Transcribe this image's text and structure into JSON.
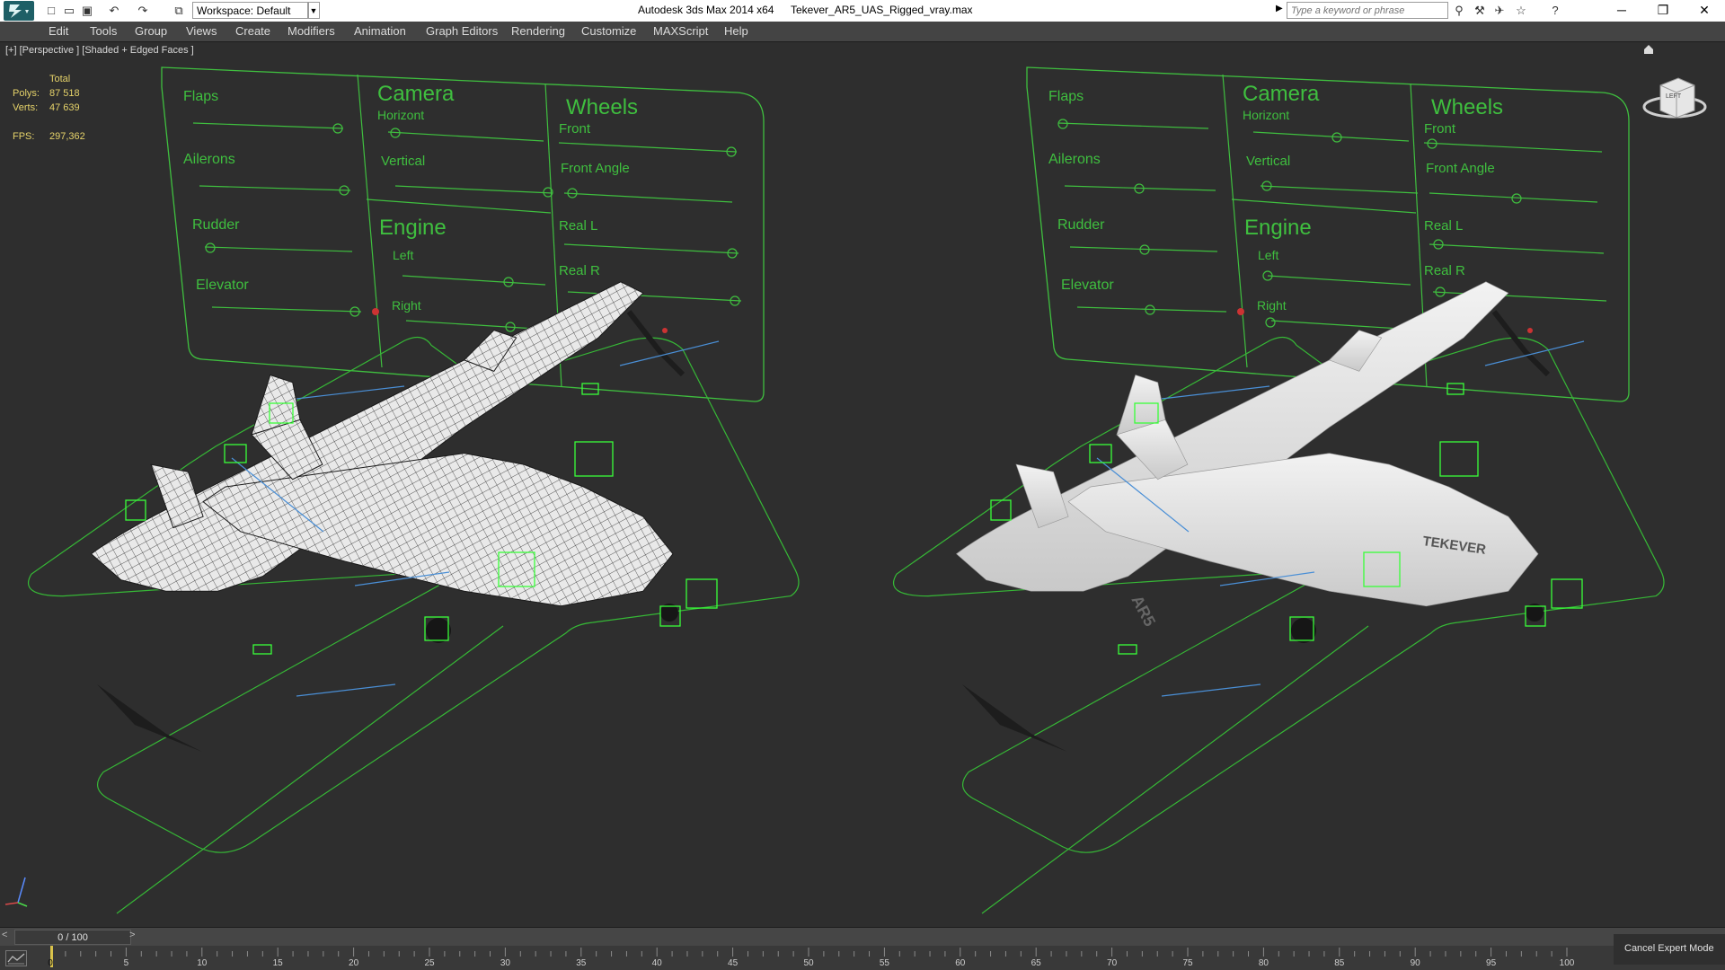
{
  "titlebar": {
    "app_title": "Autodesk 3ds Max  2014 x64",
    "file_name": "Tekever_AR5_UAS_Rigged_vray.max",
    "workspace": "Workspace: Default",
    "search_placeholder": "Type a keyword or phrase"
  },
  "menu": [
    "Edit",
    "Tools",
    "Group",
    "Views",
    "Create",
    "Modifiers",
    "Animation",
    "Graph Editors",
    "Rendering",
    "Customize",
    "MAXScript",
    "Help"
  ],
  "viewport": {
    "label": "[+] [Perspective ] [Shaded + Edged Faces ]",
    "stats": {
      "header": "Total",
      "polys_label": "Polys:",
      "polys": "87 518",
      "verts_label": "Verts:",
      "verts": "47 639",
      "fps_label": "FPS:",
      "fps": "297,362"
    },
    "viewcube_label": "LEFT"
  },
  "rig_panel": {
    "left_section": [
      "Flaps",
      "Ailerons",
      "Rudder",
      "Elevator"
    ],
    "camera_title": "Camera",
    "camera_items": [
      "Horizont",
      "Vertical"
    ],
    "engine_title": "Engine",
    "engine_items": [
      "Left",
      "Right"
    ],
    "wheels_title": "Wheels",
    "wheels_items": [
      "Front",
      "Front Angle",
      "Real L",
      "Real R"
    ]
  },
  "aircraft_label": "TEKEVER",
  "aircraft_tail": "AR5",
  "timeline": {
    "frame_display": "0 / 100",
    "left_arrow": "<",
    "right_arrow": ">",
    "current_frame": "0",
    "ticks": [
      "5",
      "10",
      "15",
      "20",
      "25",
      "30",
      "35",
      "40",
      "45",
      "50",
      "55",
      "60",
      "65",
      "70",
      "75",
      "80",
      "85",
      "90",
      "95",
      "100"
    ],
    "cancel_expert": "Cancel Expert Mode"
  },
  "colors": {
    "rig_green": "#3fbf3f",
    "bright_green": "#39ff39",
    "background": "#2e2e2e",
    "stats_yellow": "#e6d36a"
  }
}
